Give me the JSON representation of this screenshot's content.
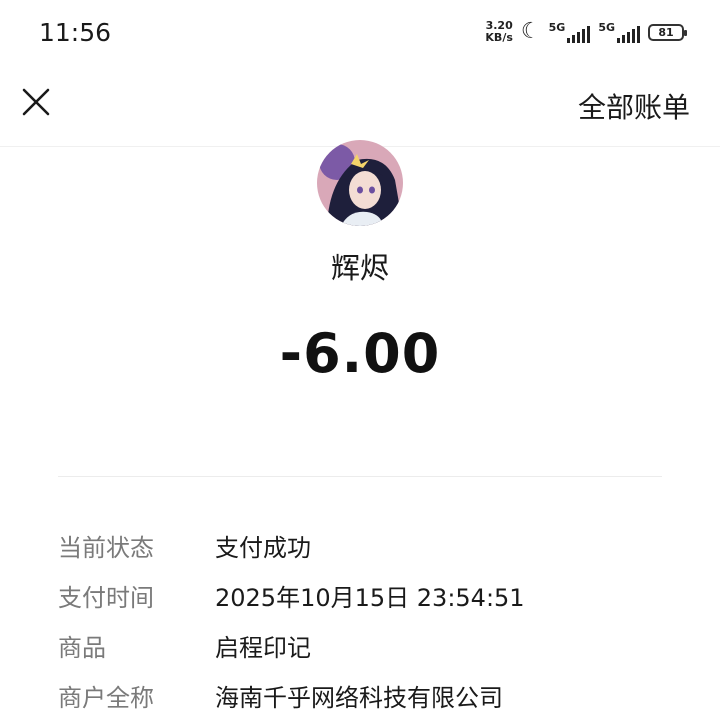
{
  "status_bar": {
    "time": "11:56",
    "speed_value": "3.20",
    "speed_unit": "KB/s",
    "net1_label": "5G",
    "net2_label": "5G",
    "battery": "81"
  },
  "nav": {
    "close_icon": "close-icon",
    "all_bills_label": "全部账单"
  },
  "payee": {
    "name": "辉烬",
    "amount": "-6.00"
  },
  "details": [
    {
      "label": "当前状态",
      "value": "支付成功"
    },
    {
      "label": "支付时间",
      "value": "2025年10月15日 23:54:51"
    },
    {
      "label": "商品",
      "value": "启程印记"
    },
    {
      "label": "商户全称",
      "value": "海南千乎网络科技有限公司"
    }
  ],
  "colors": {
    "text_primary": "#1a1a1a",
    "text_secondary": "#7a7a7a",
    "divider": "#ececec"
  }
}
